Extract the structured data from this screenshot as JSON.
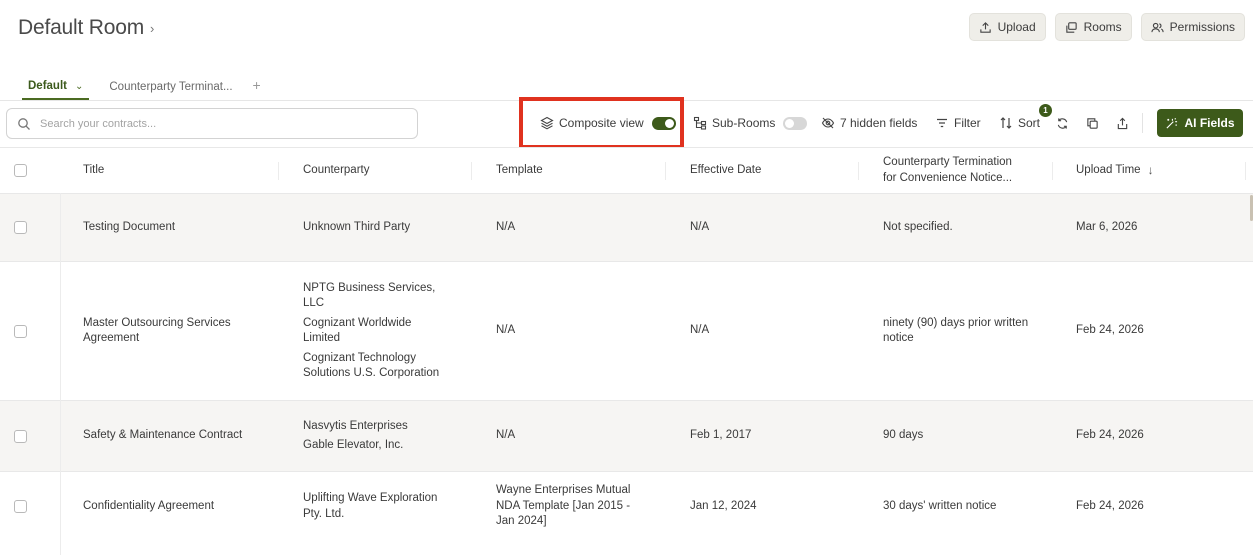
{
  "page": {
    "title": "Default Room"
  },
  "top_actions": {
    "upload": "Upload",
    "rooms": "Rooms",
    "permissions": "Permissions"
  },
  "tabs": [
    {
      "label": "Default",
      "active": true
    },
    {
      "label": "Counterparty Terminat...",
      "active": false
    }
  ],
  "search": {
    "placeholder": "Search your contracts..."
  },
  "toolbar": {
    "composite_view": "Composite view",
    "composite_view_on": true,
    "sub_rooms": "Sub-Rooms",
    "sub_rooms_on": false,
    "hidden_fields": "7 hidden fields",
    "filter": "Filter",
    "sort": "Sort",
    "sort_badge": "1",
    "ai_fields": "AI Fields"
  },
  "colors": {
    "accent": "#3d5a1a",
    "highlight": "#e0321f",
    "shaded_row": "#f6f5f3"
  },
  "columns": {
    "title": "Title",
    "counterparty": "Counterparty",
    "template": "Template",
    "effective_date": "Effective Date",
    "termination_line1": "Counterparty Termination",
    "termination_line2": "for Convenience Notice...",
    "upload_time": "Upload Time"
  },
  "rows": [
    {
      "title": [
        "Testing Document"
      ],
      "counterparty": [
        "Unknown Third Party"
      ],
      "template": [
        "N/A"
      ],
      "effective_date": "N/A",
      "termination": [
        "Not specified."
      ],
      "upload_time": "Mar 6, 2026"
    },
    {
      "title": [
        "Master Outsourcing Services",
        "Agreement"
      ],
      "counterparty": [
        "NPTG Business Services,|LLC",
        "Cognizant Worldwide|Limited",
        "Cognizant Technology|Solutions U.S. Corporation"
      ],
      "template": [
        "N/A"
      ],
      "effective_date": "N/A",
      "termination": [
        "ninety (90) days prior written",
        "notice"
      ],
      "upload_time": "Feb 24, 2026"
    },
    {
      "title": [
        "Safety & Maintenance Contract"
      ],
      "counterparty": [
        "Nasvytis Enterprises",
        "Gable Elevator, Inc."
      ],
      "template": [
        "N/A"
      ],
      "effective_date": "Feb 1, 2017",
      "termination": [
        "90 days"
      ],
      "upload_time": "Feb 24, 2026"
    },
    {
      "title": [
        "Confidentiality Agreement"
      ],
      "counterparty": [
        "Uplifting Wave Exploration|Pty. Ltd."
      ],
      "template": [
        "Wayne Enterprises Mutual",
        "NDA Template [Jan 2015 -",
        "Jan 2024]"
      ],
      "effective_date": "Jan 12, 2024",
      "termination": [
        "30 days' written notice"
      ],
      "upload_time": "Feb 24, 2026"
    }
  ]
}
